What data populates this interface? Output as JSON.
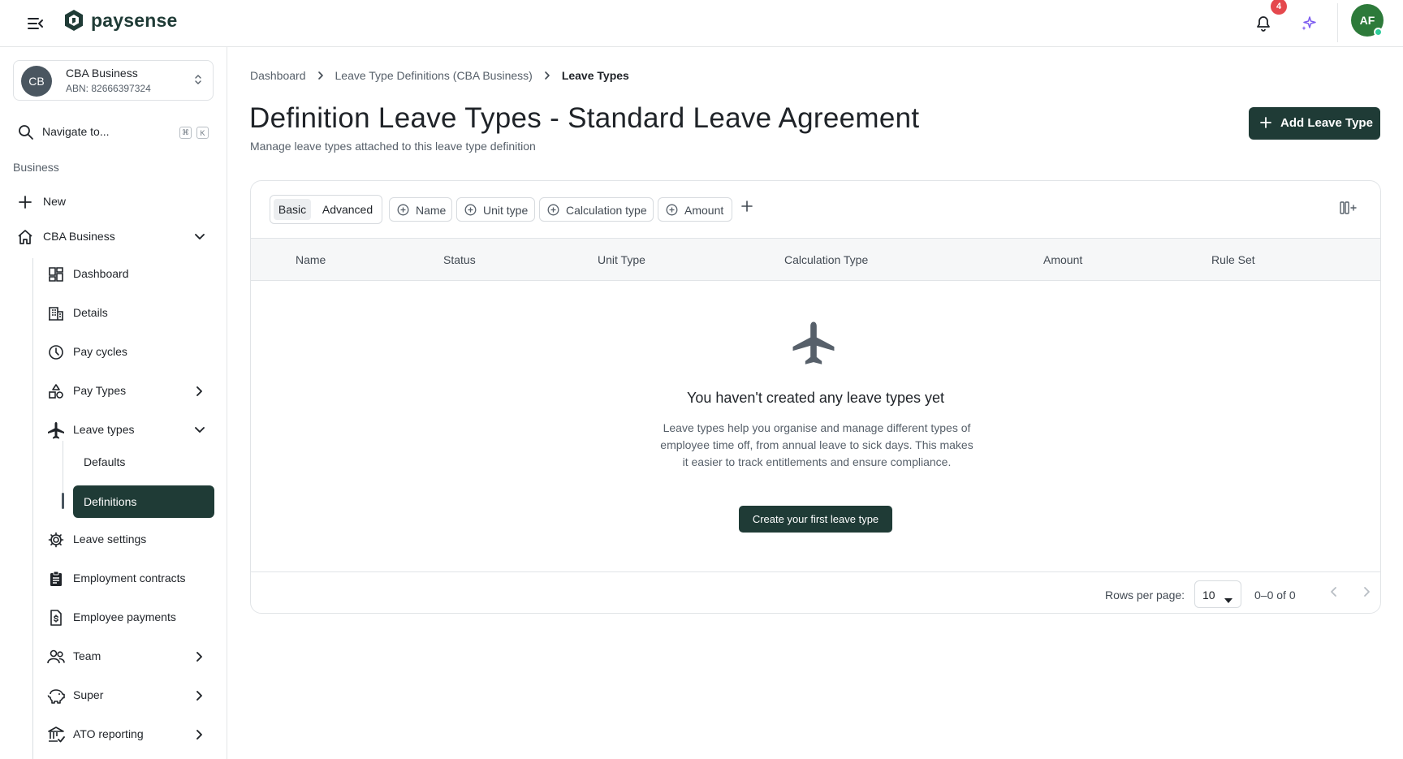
{
  "topbar": {
    "menu_icon": "menu-collapse-icon",
    "logo_icon": "paysense-hex-logo",
    "brand": "paysense",
    "notification_count": "4",
    "avatar_initials": "AF",
    "colors": {
      "brand": "#1f3b36",
      "badge": "#e5484d",
      "avatar": "#2d7a3a",
      "sparkle": "#7c5cf0"
    }
  },
  "sidebar": {
    "business": {
      "initials": "CB",
      "name": "CBA Business",
      "abn": "ABN: 82666397324"
    },
    "search": {
      "label": "Navigate to...",
      "shortcut_1": "⌘",
      "shortcut_2": "K"
    },
    "section_label": "Business",
    "new_label": "New",
    "group_label": "CBA Business",
    "items": [
      {
        "label": "Dashboard",
        "icon": "dashboard-icon"
      },
      {
        "label": "Details",
        "icon": "building-icon"
      },
      {
        "label": "Pay cycles",
        "icon": "clock-icon"
      },
      {
        "label": "Pay Types",
        "icon": "shapes-icon"
      },
      {
        "label": "Leave types",
        "icon": "airplane-icon"
      },
      {
        "label": "Defaults"
      },
      {
        "label": "Definitions"
      },
      {
        "label": "Leave settings",
        "icon": "gear-icon"
      },
      {
        "label": "Employment contracts",
        "icon": "clipboard-icon"
      },
      {
        "label": "Employee payments",
        "icon": "dollar-doc-icon"
      },
      {
        "label": "Team",
        "icon": "people-icon"
      },
      {
        "label": "Super",
        "icon": "piggy-bank-icon"
      },
      {
        "label": "ATO reporting",
        "icon": "bank-icon"
      }
    ]
  },
  "breadcrumb": [
    "Dashboard",
    "Leave Type Definitions (CBA Business)",
    "Leave Types"
  ],
  "page": {
    "title": "Definition Leave Types - Standard Leave Agreement",
    "subtitle": "Manage leave types attached to this leave type definition",
    "add_button": "Add Leave Type"
  },
  "filters": {
    "mode_basic": "Basic",
    "mode_advanced": "Advanced",
    "mode_selected": "Basic",
    "chips": [
      "Name",
      "Unit type",
      "Calculation type",
      "Amount"
    ]
  },
  "table": {
    "columns": [
      "Name",
      "Status",
      "Unit Type",
      "Calculation Type",
      "Amount",
      "Rule Set"
    ],
    "rows": []
  },
  "empty_state": {
    "icon": "airplane-icon",
    "title": "You haven't created any leave types yet",
    "description": "Leave types help you organise and manage different types of employee time off, from annual leave to sick days. This makes it easier to track entitlements and ensure compliance.",
    "button": "Create your first leave type"
  },
  "pagination": {
    "rows_per_page_label": "Rows per page:",
    "rows_per_page": "10",
    "range": "0–0 of 0"
  }
}
